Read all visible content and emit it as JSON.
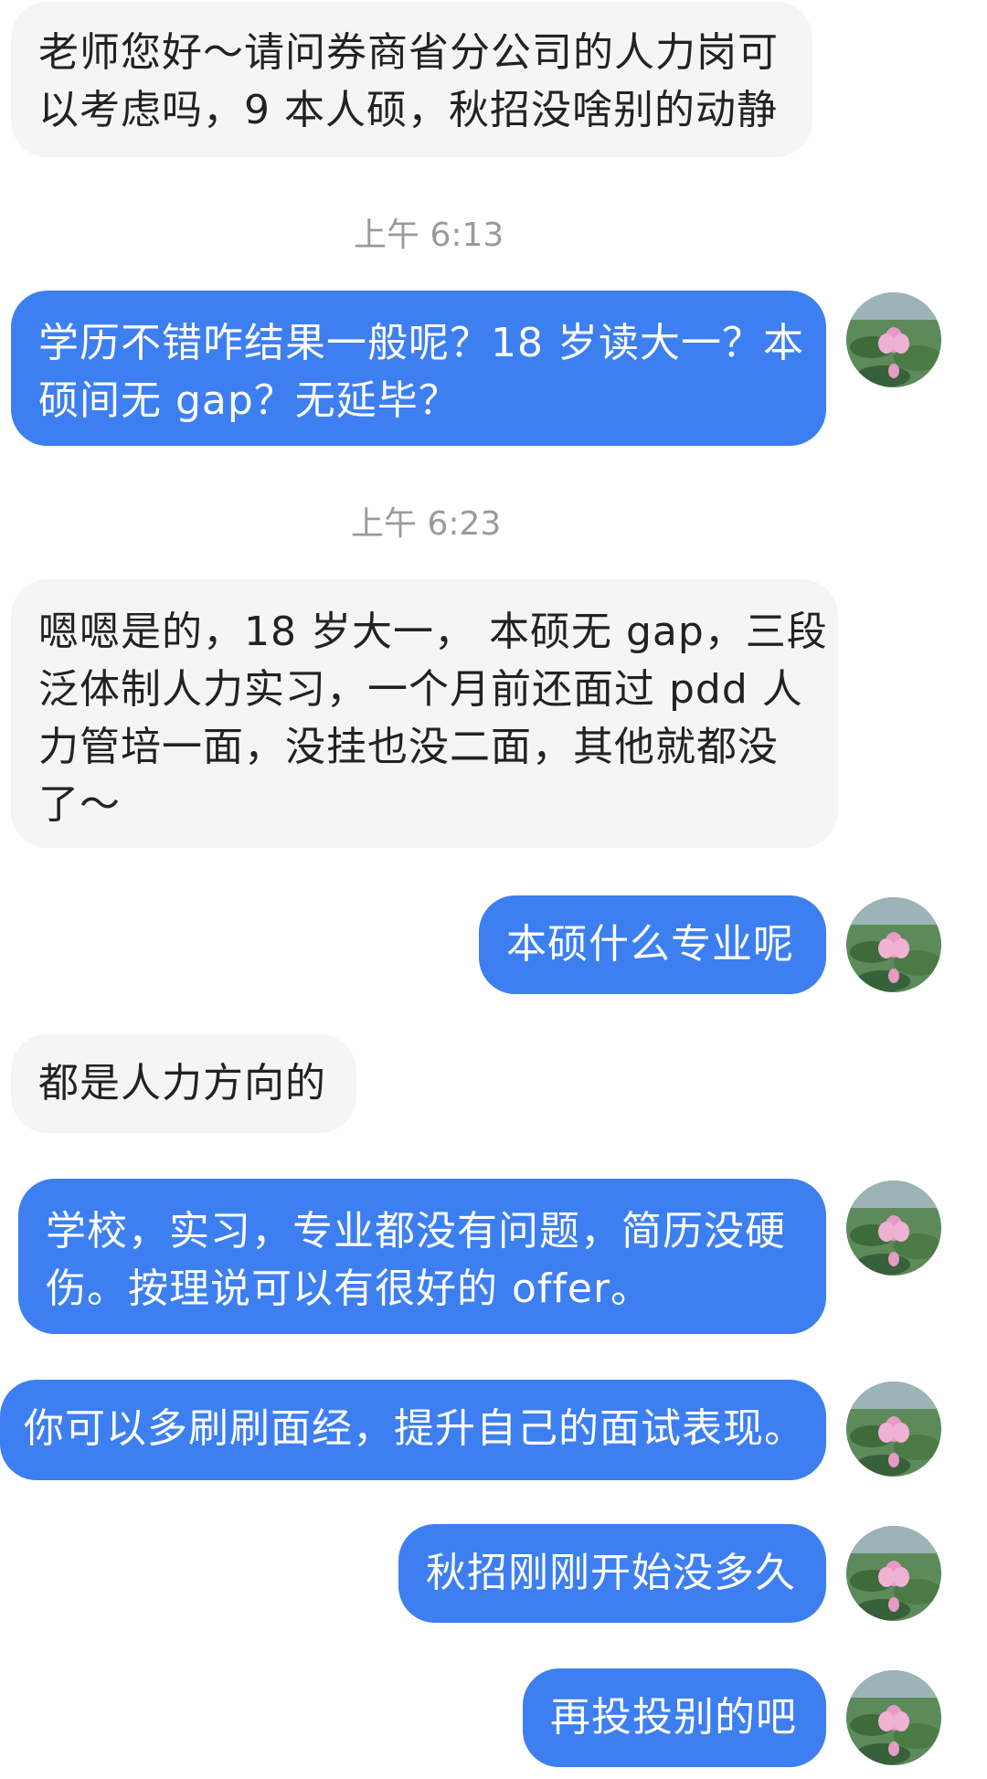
{
  "colors": {
    "incoming_bubble": "#f5f5f5",
    "outgoing_bubble": "#3d7ff0",
    "timestamp_text": "#9a9a9a"
  },
  "avatar_icon": "lotus-pond-avatar",
  "messages": [
    {
      "side": "incoming",
      "text": "老师您好～请问券商省分公司的人力岗可\n以考虑吗，9 本人硕，秋招没啥别的动静"
    },
    {
      "type": "timestamp",
      "text": "上午 6:13"
    },
    {
      "side": "outgoing",
      "text": "学历不错咋结果一般呢？18 岁读大一？本\n硕间无 gap？无延毕？"
    },
    {
      "type": "timestamp",
      "text": "上午 6:23"
    },
    {
      "side": "incoming",
      "text": "嗯嗯是的，18 岁大一， 本硕无 gap，三段\n泛体制人力实习，一个月前还面过 pdd 人\n力管培一面，没挂也没二面，其他就都没\n了～"
    },
    {
      "side": "outgoing",
      "text": "本硕什么专业呢"
    },
    {
      "side": "incoming",
      "text": "都是人力方向的"
    },
    {
      "side": "outgoing",
      "text": "学校，实习，专业都没有问题，简历没硬\n伤。按理说可以有很好的 offer。"
    },
    {
      "side": "outgoing",
      "text": "你可以多刷刷面经，提升自己的面试表现。"
    },
    {
      "side": "outgoing",
      "text": "秋招刚刚开始没多久"
    },
    {
      "side": "outgoing",
      "text": "再投投别的吧"
    }
  ]
}
